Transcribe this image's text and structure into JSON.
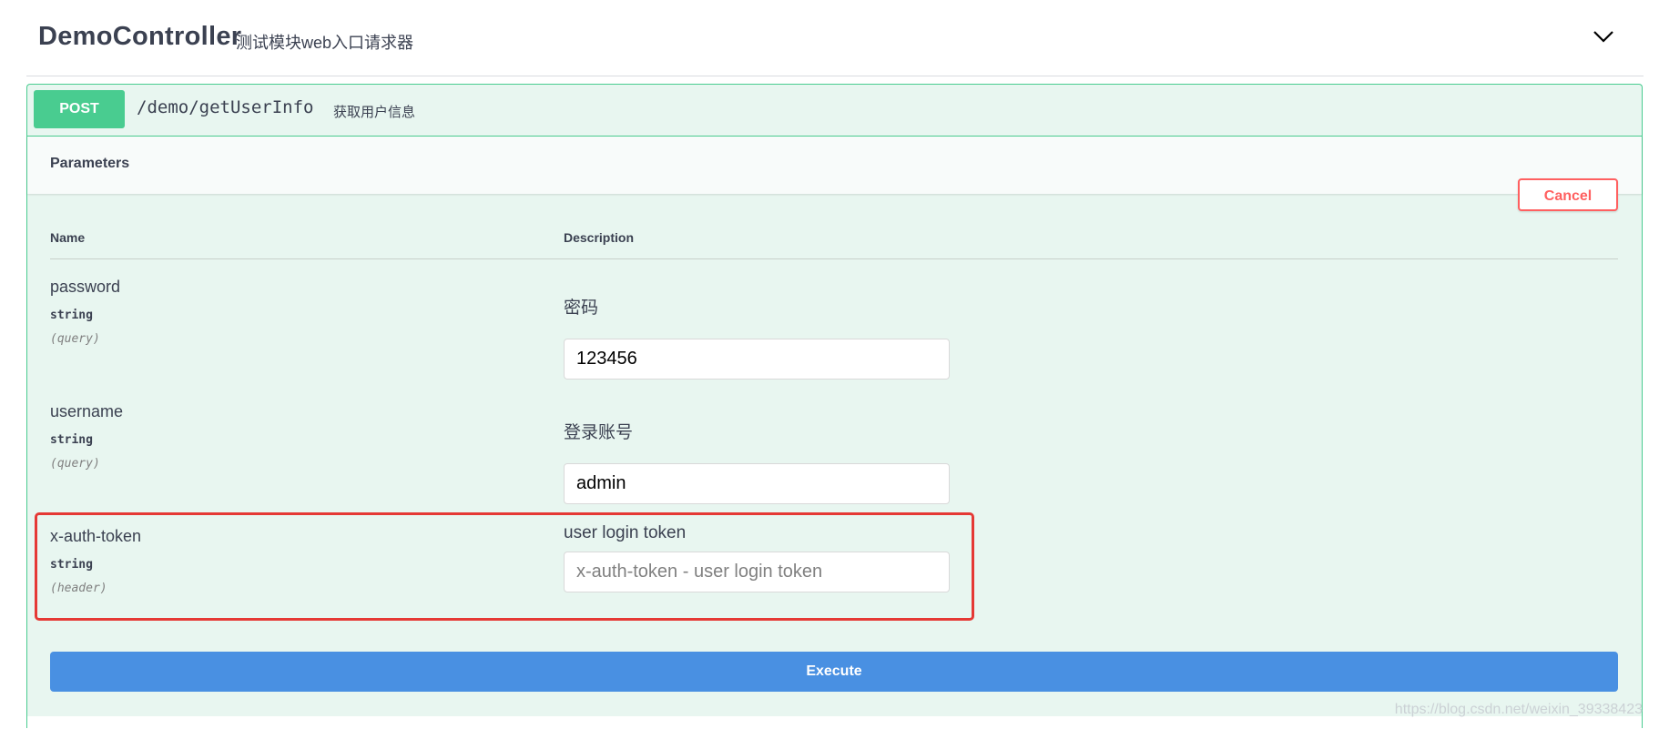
{
  "tag": {
    "title": "DemoController",
    "description": "测试模块web入口请求器"
  },
  "operation": {
    "method": "POST",
    "path": "/demo/getUserInfo",
    "summary": "获取用户信息"
  },
  "parameters_section": {
    "title": "Parameters",
    "cancel_label": "Cancel",
    "columns": {
      "name": "Name",
      "description": "Description"
    }
  },
  "params": [
    {
      "name": "password",
      "type": "string",
      "in": "(query)",
      "description": "密码",
      "value": "123456",
      "placeholder": ""
    },
    {
      "name": "username",
      "type": "string",
      "in": "(query)",
      "description": "登录账号",
      "value": "admin",
      "placeholder": ""
    },
    {
      "name": "x-auth-token",
      "type": "string",
      "in": "(header)",
      "description": "user login token",
      "value": "",
      "placeholder": "x-auth-token - user login token"
    }
  ],
  "execute_label": "Execute",
  "watermark": "https://blog.csdn.net/weixin_39338423",
  "colors": {
    "post_green": "#49cc90",
    "post_bg": "#e8f6f0",
    "cancel_red": "#ff6060",
    "execute_blue": "#4990e2",
    "highlight_red": "#e53935"
  },
  "icons": {
    "collapse": "chevron-down-icon"
  }
}
